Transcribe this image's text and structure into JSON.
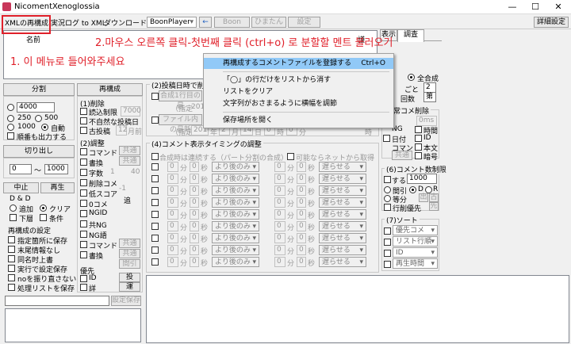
{
  "window": {
    "title": "NicomentXenoglossia",
    "minimize": "—",
    "maximize": "☐",
    "close": "✕"
  },
  "menu": {
    "items": [
      "XMLの再構成",
      "実況ログ to XML",
      "ダウンロード"
    ],
    "player": "BoonPlayer",
    "arrow": "←",
    "boon": "Boon",
    "hinagata": "ひまたん",
    "settings": "設定",
    "detail": "詳細設定"
  },
  "list": {
    "header": "名前",
    "header_tail": "謹"
  },
  "tabs": {
    "t1": "表示",
    "t2": "調査"
  },
  "annotations": {
    "a1": "1. 이 메뉴로 들어와주세요",
    "a2": "2.마우스 오른쪽 클릭-첫번째 클릭 (ctrl+o) 로 분할할 멘트 불러오기"
  },
  "context_menu": {
    "items": [
      {
        "label": "再構成するコメントファイルを登録する",
        "shortcut": "Ctrl+O"
      },
      {
        "label": "「◯」の行だけをリストから消す"
      },
      {
        "label": "リストをクリア"
      },
      {
        "label": "文字列がおさまるように横幅を調節"
      },
      {
        "label": "保存場所を開く"
      }
    ]
  },
  "split": {
    "title": "分割",
    "value": "4000",
    "r250": "250",
    "r500": "500",
    "r1000": "1000",
    "auto": "自動",
    "shuffle": "順番も出力する",
    "cutout": "切り出し",
    "from": "0",
    "tilde": "〜",
    "to": "1000"
  },
  "reconf": {
    "title": "再構成",
    "del": "(1)削除",
    "readlimit": "読込制限",
    "readlimit_v": "7000",
    "unnatural": "不自然な投稿日",
    "oldpost": "古投稿",
    "oldpost_v": "12",
    "month": "月前",
    "adjust": "(2)調整",
    "command": "コマンド",
    "tenkai": "共通",
    "nonbox": "書換",
    "chars": "字数",
    "chars_a": "1",
    "chars_b": "40",
    "delcomment": "削除コメ",
    "lowscore": "低スコア",
    "lowscore_v": "-1",
    "zero": "0コメ",
    "ng": "NGID",
    "kyong": "共NG",
    "ngword": "NG語",
    "nadd": "追",
    "cmd2": "コマンド",
    "kyo2": "共通",
    "shoka": "書換",
    "kyo3": "共通",
    "gap": "間引",
    "pri": "優先",
    "id": "ID",
    "toko": "投",
    " shi": "シ",
    "shou": "詳",
    "un": "運"
  },
  "play": {
    "stop": "中止",
    "play": "再生",
    "dd": "D & D",
    "add": "追加",
    "clear": "クリア",
    "down": "下層",
    "cond": "条件"
  },
  "settings_panel": {
    "title": "再構成の設定",
    "s1": "指定箇所に保存",
    "s2": "末尾情報なし",
    "s3": "同名时上書",
    "s4": "実行で設定保存",
    "s5": "noを振り直さない",
    "s6": "処理リストを保存",
    "save": "設定保存"
  },
  "post": {
    "title": "(2)投稿日時で削除",
    "line1": "合成1行目の最",
    "spec": "（指定",
    "spec_v": "201",
    "file": "ファイル内の最新",
    "date2": "201",
    "y": "年",
    "m": "2",
    "mon": "月",
    "d": "14",
    "day": "日",
    "h": "0",
    "hour": "時",
    "mi": "0",
    "min": "分",
    "time2": "時"
  },
  "timing": {
    "title": "(4)コメント表示タイミングの調整",
    "sub": "合成時は連続する（パート分割の合成）",
    "net": "可能ならネットから取得",
    "zero": "0",
    "fen": "分",
    "miao": "秒",
    "opt_early": "より後のみ",
    "opt_late": "遅らせる"
  },
  "right": {
    "all": "全合成",
    "every": "ごと",
    "every_v": "2",
    "cnt": "回数",
    "cnt_v": "第",
    "del_title": "通常コメ削除",
    "thr": "0ms",
    "ng": "NG",
    "time": "時間",
    "date": "日付",
    "idl": "ID",
    "cmdl": "コマンド",
    "bunl": "本文",
    "kyo": "共通",
    "hash": "暗号",
    "dup": "(6)コメント数制限",
    "suru": "する",
    "suru_v": "1000",
    "thin": "間引",
    "d": "D",
    "r": "R",
    "even": "等分",
    "n1": "出",
    "n2": "古",
    "rowprio": "行削優先",
    "first": "先",
    "sort": "(7)ソート",
    "s1": "優先コメ",
    "s2": "リスト行順",
    "s3": "ID",
    "s4": "再生時間"
  }
}
